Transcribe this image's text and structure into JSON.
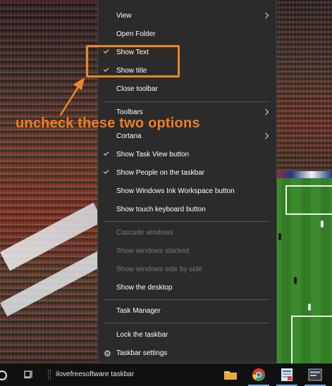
{
  "context_menu": {
    "items": [
      {
        "label": "View",
        "checked": false,
        "submenu": true,
        "disabled": false
      },
      {
        "label": "Open Folder",
        "checked": false,
        "submenu": false,
        "disabled": false
      },
      {
        "label": "Show Text",
        "checked": true,
        "submenu": false,
        "disabled": false
      },
      {
        "label": "Show title",
        "checked": true,
        "submenu": false,
        "disabled": false
      },
      {
        "label": "Close toolbar",
        "checked": false,
        "submenu": false,
        "disabled": false
      },
      {
        "label": "Toolbars",
        "checked": false,
        "submenu": true,
        "disabled": false
      },
      {
        "label": "Cortana",
        "checked": false,
        "submenu": true,
        "disabled": false
      },
      {
        "label": "Show Task View button",
        "checked": true,
        "submenu": false,
        "disabled": false
      },
      {
        "label": "Show People on the taskbar",
        "checked": true,
        "submenu": false,
        "disabled": false
      },
      {
        "label": "Show Windows Ink Workspace button",
        "checked": false,
        "submenu": false,
        "disabled": false
      },
      {
        "label": "Show touch keyboard button",
        "checked": false,
        "submenu": false,
        "disabled": false
      },
      {
        "label": "Cascade windows",
        "checked": false,
        "submenu": false,
        "disabled": true
      },
      {
        "label": "Show windows stacked",
        "checked": false,
        "submenu": false,
        "disabled": true
      },
      {
        "label": "Show windows side by side",
        "checked": false,
        "submenu": false,
        "disabled": true
      },
      {
        "label": "Show the desktop",
        "checked": false,
        "submenu": false,
        "disabled": false
      },
      {
        "label": "Task Manager",
        "checked": false,
        "submenu": false,
        "disabled": false
      },
      {
        "label": "Lock the taskbar",
        "checked": false,
        "submenu": false,
        "disabled": false
      },
      {
        "label": "Taskbar settings",
        "checked": false,
        "submenu": false,
        "disabled": false,
        "icon": "gear-icon"
      }
    ]
  },
  "annotation": {
    "text": "uncheck these two options",
    "color": "#f07d1e"
  },
  "taskbar": {
    "toolbar_label": "ilovefreesoftware taskbar",
    "apps": [
      "folder-icon",
      "chrome-icon",
      "document-app-icon",
      "generic-app-icon"
    ],
    "accent": "#7aa7d9"
  },
  "colors": {
    "menu_bg": "#2b2b2b",
    "menu_text": "#ffffff",
    "menu_disabled_text": "#7a7a7a",
    "highlight_box": "#f0862a"
  }
}
